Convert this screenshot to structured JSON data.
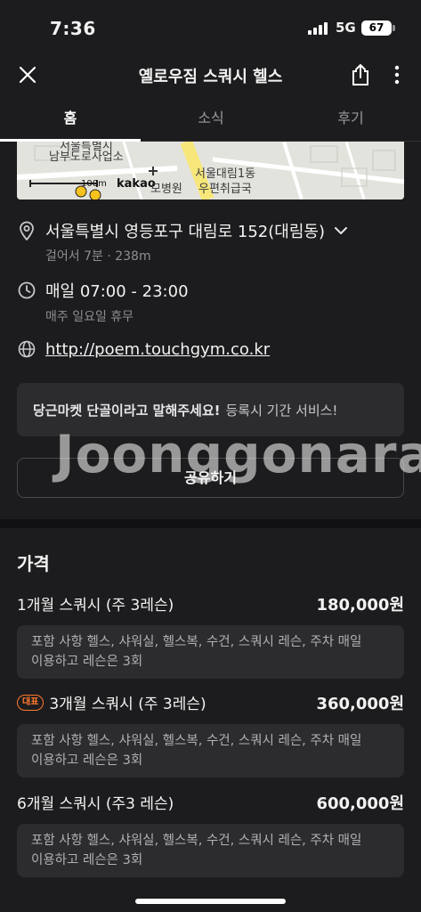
{
  "status": {
    "time": "7:36",
    "network": "5G",
    "battery": "67"
  },
  "header": {
    "title": "옐로우짐 스쿼시 헬스"
  },
  "tabs": [
    {
      "label": "홈",
      "active": true
    },
    {
      "label": "소식",
      "active": false
    },
    {
      "label": "후기",
      "active": false
    }
  ],
  "map": {
    "labels": [
      "서울특별시",
      "남부도로사업소",
      "서울대림1동",
      "우편취급국",
      "100m",
      "kakao",
      "모병원"
    ]
  },
  "location": {
    "address": "서울특별시 영등포구 대림로 152(대림동)",
    "walk": "걸어서 7분 · 238m"
  },
  "hours": {
    "time": "매일 07:00 - 23:00",
    "closed": "매주 일요일 휴무"
  },
  "website": {
    "url": "http://poem.touchgym.co.kr"
  },
  "promo": {
    "bold": "당근마켓 단골이라고 말해주세요!",
    "text": "등록시 기간 서비스!"
  },
  "watermark": "Joonggonara",
  "share_label": "공유하기",
  "price_section": {
    "title": "가격",
    "items": [
      {
        "badge": "",
        "name": "1개월 스쿼시 (주 3레슨)",
        "price": "180,000원",
        "desc_line1": "포함 사항 헬스, 샤워실, 헬스복, 수건, 스쿼시 레슨, 주차 매일",
        "desc_line2": "이용하고 레슨은 3회"
      },
      {
        "badge": "대표",
        "name": "3개월 스쿼시 (주 3레슨)",
        "price": "360,000원",
        "desc_line1": "포함 사항 헬스, 샤워실, 헬스복, 수건, 스쿼시 레슨, 주차 매일",
        "desc_line2": "이용하고 레슨은 3회"
      },
      {
        "badge": "",
        "name": "6개월 스쿼시 (주3 레슨)",
        "price": "600,000원",
        "desc_line1": "포함 사항 헬스, 샤워실, 헬스복, 수건, 스쿼시 레슨, 주차 매일",
        "desc_line2": "이용하고 레슨은 3회"
      }
    ]
  },
  "colors": {
    "background": "#1c1c1e",
    "card": "#2c2c2e",
    "accent": "#ff7a2f",
    "map": "#e3e3de"
  }
}
